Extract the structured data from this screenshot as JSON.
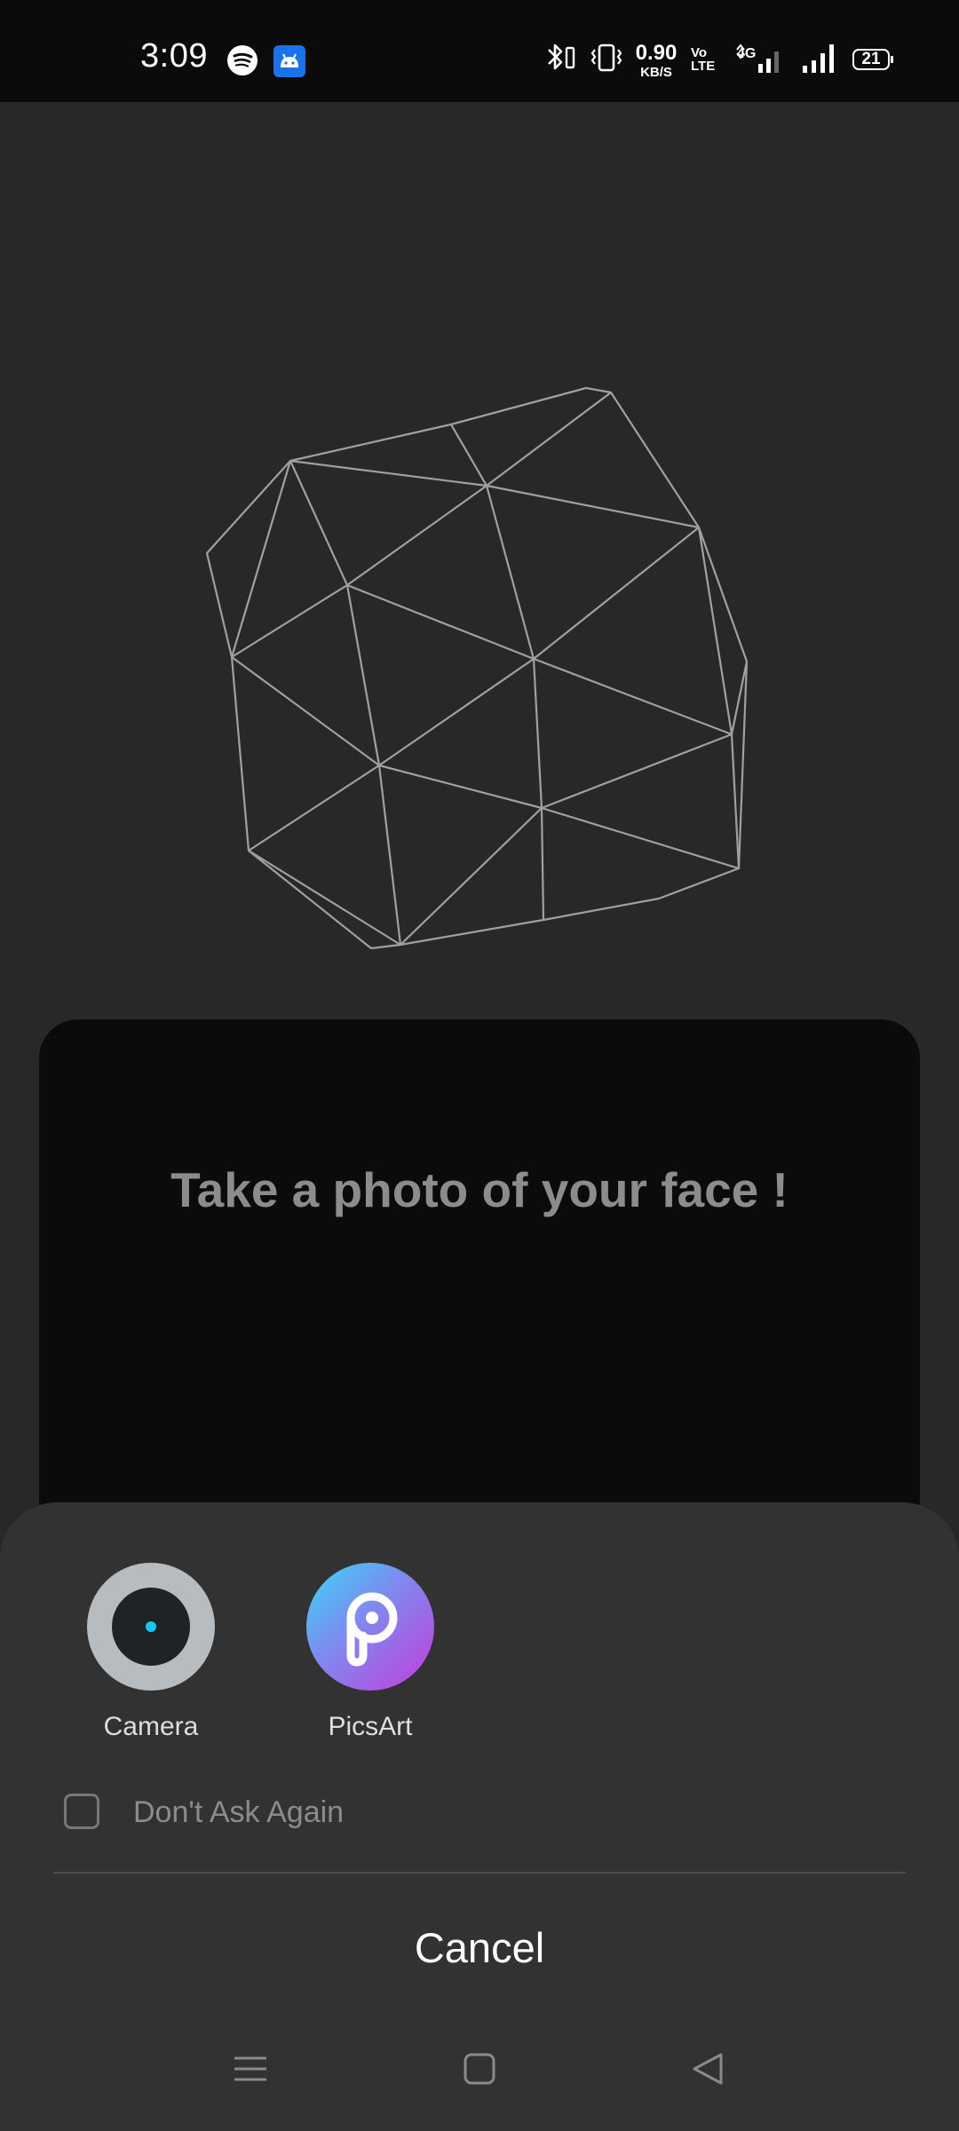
{
  "status_bar": {
    "time": "3:09",
    "notification_icons": [
      "spotify-icon",
      "android-icon"
    ],
    "system_icons": [
      "bluetooth-icon",
      "vibrate-icon",
      "volte-icon",
      "4g-icon",
      "signal-icon",
      "battery-icon"
    ],
    "data_speed_value": "0.90",
    "data_speed_unit": "KB/S",
    "volte_label_top": "Vo",
    "volte_label_bottom": "LTE",
    "network_type": "4G",
    "battery_level": "21"
  },
  "main": {
    "card_title": "Take a photo of your face !"
  },
  "chooser_sheet": {
    "apps": [
      {
        "label": "Camera",
        "icon": "camera-icon"
      },
      {
        "label": "PicsArt",
        "icon": "picsart-icon"
      }
    ],
    "dont_ask_again_label": "Don't Ask Again",
    "dont_ask_again_checked": false,
    "cancel_label": "Cancel"
  },
  "nav_bar": {
    "buttons": [
      "menu-icon",
      "home-icon",
      "back-icon"
    ]
  },
  "colors": {
    "background": "#282828",
    "card": "#0b0b0b",
    "sheet": "#323232",
    "mesh_stroke": "#a0a0a0",
    "camera_lens": "#16c8f5"
  }
}
